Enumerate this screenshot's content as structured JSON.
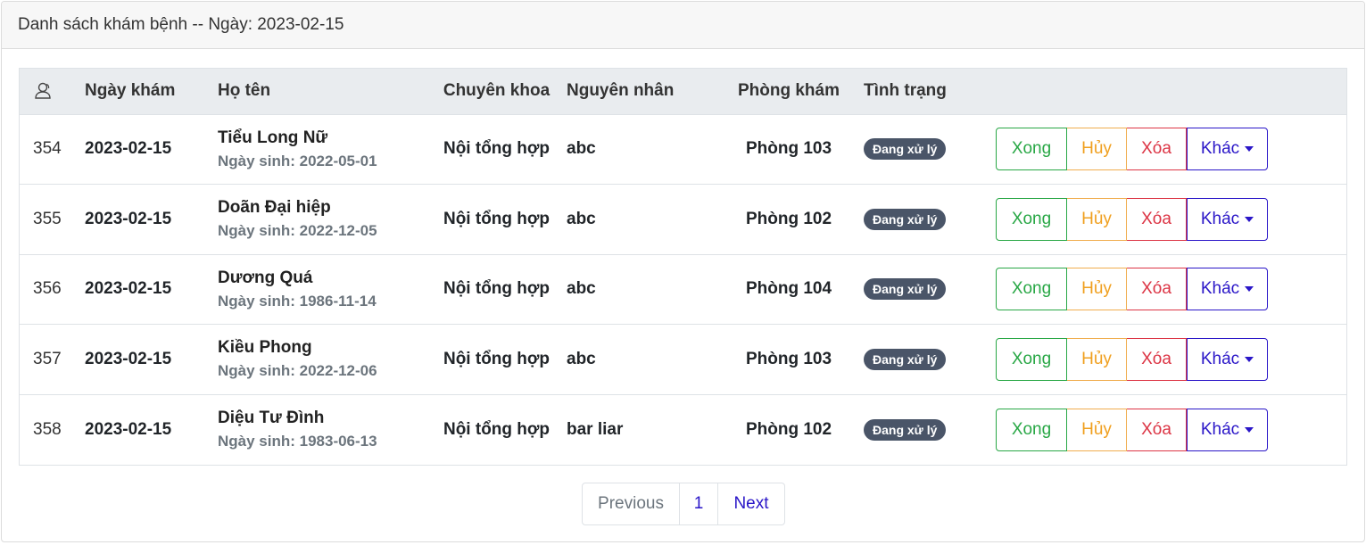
{
  "header": {
    "title": "Danh sách khám bệnh -- Ngày: 2023-02-15"
  },
  "table": {
    "columns": {
      "id_icon": "user-outline-icon",
      "date": "Ngày khám",
      "name": "Họ tên",
      "specialty": "Chuyên khoa",
      "reason": "Nguyên nhân",
      "room": "Phòng khám",
      "status": "Tình trạng"
    },
    "rows": [
      {
        "id": "354",
        "date": "2023-02-15",
        "name": "Tiểu Long Nữ",
        "dob": "Ngày sinh: 2022-05-01",
        "specialty": "Nội tổng hợp",
        "reason": "abc",
        "room": "Phòng 103",
        "status": "Đang xử lý"
      },
      {
        "id": "355",
        "date": "2023-02-15",
        "name": "Doãn Đại hiệp",
        "dob": "Ngày sinh: 2022-12-05",
        "specialty": "Nội tổng hợp",
        "reason": "abc",
        "room": "Phòng 102",
        "status": "Đang xử lý"
      },
      {
        "id": "356",
        "date": "2023-02-15",
        "name": "Dương Quá",
        "dob": "Ngày sinh: 1986-11-14",
        "specialty": "Nội tổng hợp",
        "reason": "abc",
        "room": "Phòng 104",
        "status": "Đang xử lý"
      },
      {
        "id": "357",
        "date": "2023-02-15",
        "name": "Kiều Phong",
        "dob": "Ngày sinh: 2022-12-06",
        "specialty": "Nội tổng hợp",
        "reason": "abc",
        "room": "Phòng 103",
        "status": "Đang xử lý"
      },
      {
        "id": "358",
        "date": "2023-02-15",
        "name": "Diệu Tư Đình",
        "dob": "Ngày sinh: 1983-06-13",
        "specialty": "Nội tổng hợp",
        "reason": "bar liar",
        "room": "Phòng 102",
        "status": "Đang xử lý"
      }
    ]
  },
  "actions": {
    "done": "Xong",
    "cancel": "Hủy",
    "delete": "Xóa",
    "more": "Khác"
  },
  "pagination": {
    "previous": "Previous",
    "current": "1",
    "next": "Next"
  },
  "colors": {
    "done": "#28a745",
    "cancel": "#f0ad4e",
    "delete": "#dc3545",
    "more": "#2a16c8",
    "badge": "#4a5568"
  }
}
